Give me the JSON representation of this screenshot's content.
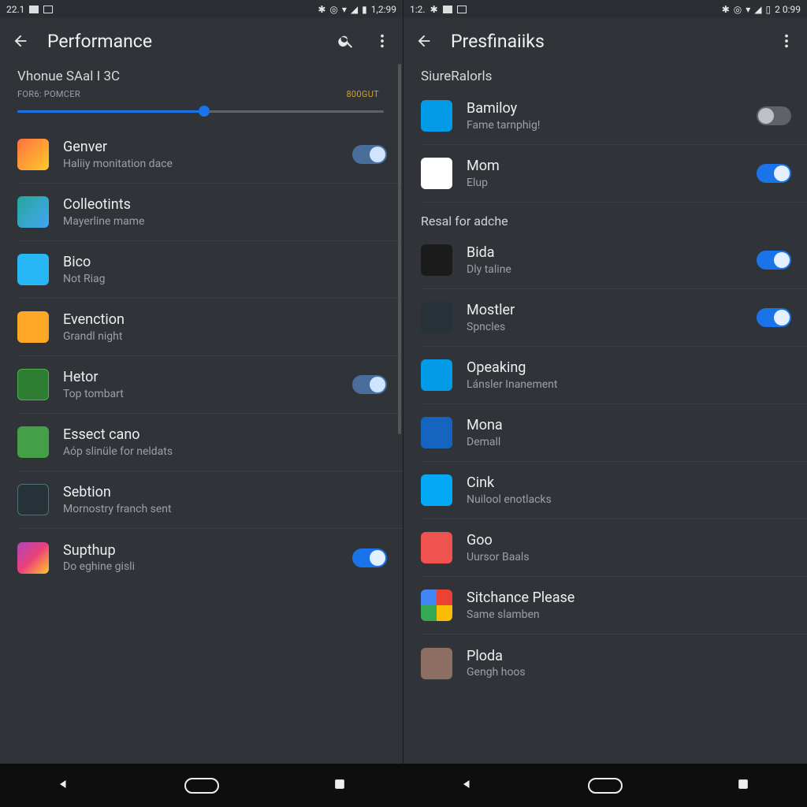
{
  "left": {
    "status": {
      "left_text": "22.1",
      "time": "1,2:99"
    },
    "title": "Performance",
    "subhead": "Vhonue SAal I 3C",
    "slider": {
      "left_label": "FOR6: POMCER",
      "right_label": "800GUT",
      "percent": 51
    },
    "rows": [
      {
        "name": "Genver",
        "sub": "Haliiy monitation dace",
        "toggle": "mid",
        "iconClass": "ic1"
      },
      {
        "name": "Colleotints",
        "sub": "Mayerline mame",
        "toggle": null,
        "iconClass": "ic2"
      },
      {
        "name": "Bico",
        "sub": "Not Riag",
        "toggle": null,
        "iconClass": "ic3"
      },
      {
        "name": "Evenction",
        "sub": "Grandl night",
        "toggle": null,
        "iconClass": "ic4"
      },
      {
        "name": "Hetor",
        "sub": "Top tombart",
        "toggle": "mid",
        "iconClass": "ic5"
      },
      {
        "name": "Essect cano",
        "sub": "Aóp slinüle for neldats",
        "toggle": null,
        "iconClass": "ic6"
      },
      {
        "name": "Sebtion",
        "sub": "Mornostry franch sent",
        "toggle": null,
        "iconClass": "ic7"
      },
      {
        "name": "Supthup",
        "sub": "Do eghine gisli",
        "toggle": "on",
        "iconClass": "ic8"
      }
    ]
  },
  "right": {
    "status": {
      "left_text": "1:2.",
      "time": "2 0:99"
    },
    "title": "Presfinaiiks",
    "section1": "SiureRalorls",
    "rows1": [
      {
        "name": "Bamiloy",
        "sub": "Fame tarnphig!",
        "toggle": "off",
        "iconClass": "icb1"
      },
      {
        "name": "Mom",
        "sub": "Elup",
        "toggle": "on",
        "iconClass": "icb2"
      }
    ],
    "section2": "Resal for adche",
    "rows2": [
      {
        "name": "Bida",
        "sub": "Dly taline",
        "toggle": "on",
        "iconClass": "icb3"
      },
      {
        "name": "Mostler",
        "sub": "Spncles",
        "toggle": "on",
        "iconClass": "icb4"
      },
      {
        "name": "Opeaking",
        "sub": "Lánsler Inanement",
        "toggle": null,
        "iconClass": "icb5"
      },
      {
        "name": "Mona",
        "sub": "Demall",
        "toggle": null,
        "iconClass": "icb6"
      },
      {
        "name": "Cink",
        "sub": "Nuilool enotlacks",
        "toggle": null,
        "iconClass": "icb7"
      },
      {
        "name": "Goo",
        "sub": "Uursor Baals",
        "toggle": null,
        "iconClass": "icb8"
      },
      {
        "name": "Sitchance Please",
        "sub": "Same slamben",
        "toggle": null,
        "iconClass": "icb9"
      },
      {
        "name": "Ploda",
        "sub": "Gengh hoos",
        "toggle": null,
        "iconClass": "icb10"
      }
    ]
  }
}
